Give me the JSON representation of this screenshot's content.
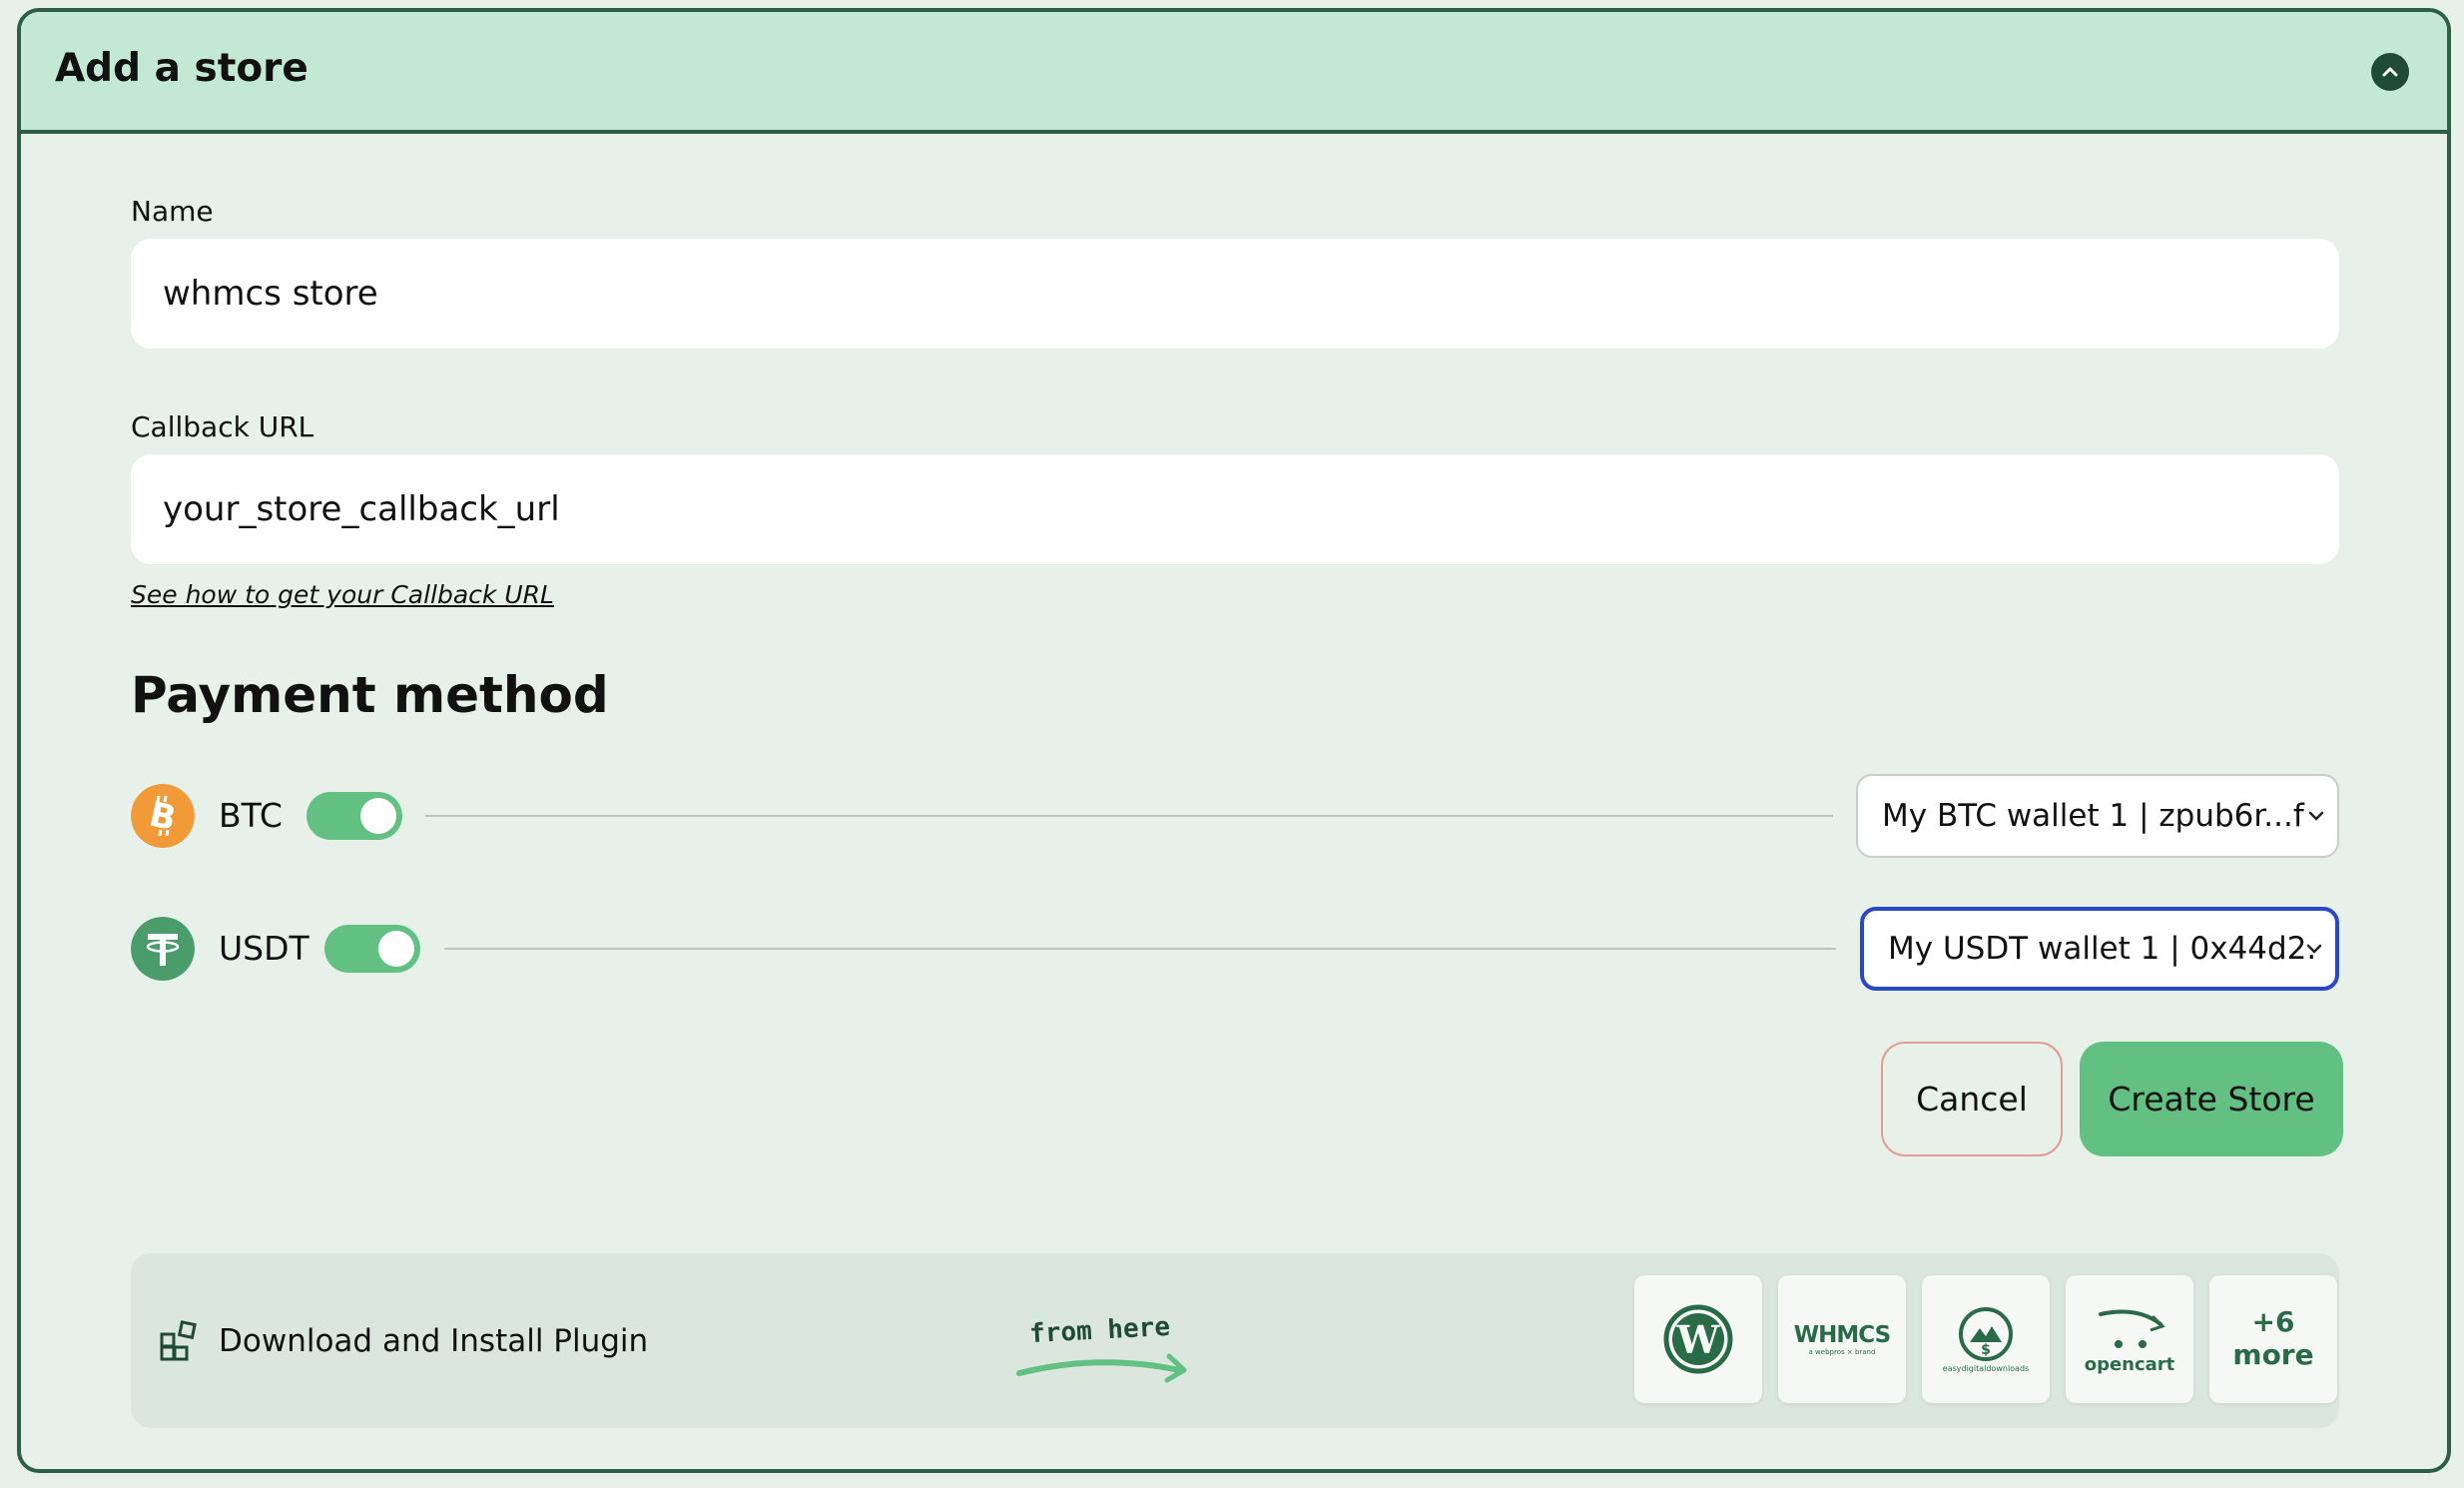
{
  "header": {
    "title": "Add a store",
    "collapse_icon": "chevron-up-icon"
  },
  "form": {
    "name": {
      "label": "Name",
      "value": "whmcs store"
    },
    "callback": {
      "label": "Callback URL",
      "value": "your_store_callback_url",
      "help_link": "See how to get your Callback URL"
    }
  },
  "payment": {
    "title": "Payment method",
    "methods": [
      {
        "label": "BTC",
        "icon": "bitcoin-icon",
        "enabled": true,
        "wallet": "My BTC wallet 1 | zpub6r...f",
        "color": "#f09a38"
      },
      {
        "label": "USDT",
        "icon": "tether-icon",
        "enabled": true,
        "wallet": "My USDT wallet 1 | 0x44d2.",
        "color": "#4a9c6b"
      }
    ]
  },
  "actions": {
    "cancel": "Cancel",
    "create": "Create Store"
  },
  "plugins": {
    "label": "Download and Install Plugin",
    "annotation": "from here",
    "items": [
      {
        "name": "wordpress",
        "icon": "wordpress-icon"
      },
      {
        "name": "WHMCS",
        "tagline": "a webpros × brand",
        "icon": "whmcs-logo"
      },
      {
        "name": "easydigitaldownloads",
        "icon": "edd-logo"
      },
      {
        "name": "opencart",
        "icon": "opencart-logo"
      }
    ],
    "more_count": "+6",
    "more_label": "more"
  },
  "colors": {
    "accent_green": "#63c083",
    "header_bg": "#c3e8d4",
    "border_dark": "#2e5e45",
    "focus_blue": "#2848c8",
    "cancel_border": "#e29b96"
  }
}
